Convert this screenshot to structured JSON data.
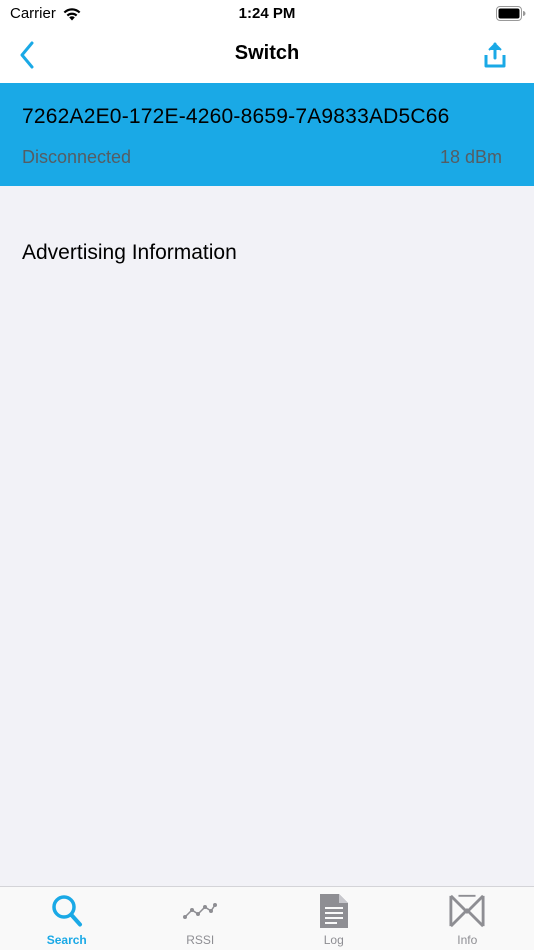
{
  "status_bar": {
    "carrier": "Carrier",
    "time": "1:24 PM"
  },
  "nav": {
    "title": "Switch",
    "back_icon": "chevron-left-icon",
    "share_icon": "share-upload-icon"
  },
  "device": {
    "uuid": "7262A2E0-172E-4260-8659-7A9833AD5C66",
    "status": "Disconnected",
    "rssi": "18 dBm"
  },
  "sections": {
    "advertising_title": "Advertising Information"
  },
  "tabs": [
    {
      "label": "Search",
      "icon": "search-icon",
      "active": true
    },
    {
      "label": "RSSI",
      "icon": "rssi-graph-icon",
      "active": false
    },
    {
      "label": "Log",
      "icon": "log-document-icon",
      "active": false
    },
    {
      "label": "Info",
      "icon": "info-logo-icon",
      "active": false
    }
  ],
  "colors": {
    "accent": "#1aa9e6",
    "header_bg": "#1aa9e6",
    "page_bg": "#f2f2f7",
    "inactive_tab": "#8e8e93"
  }
}
